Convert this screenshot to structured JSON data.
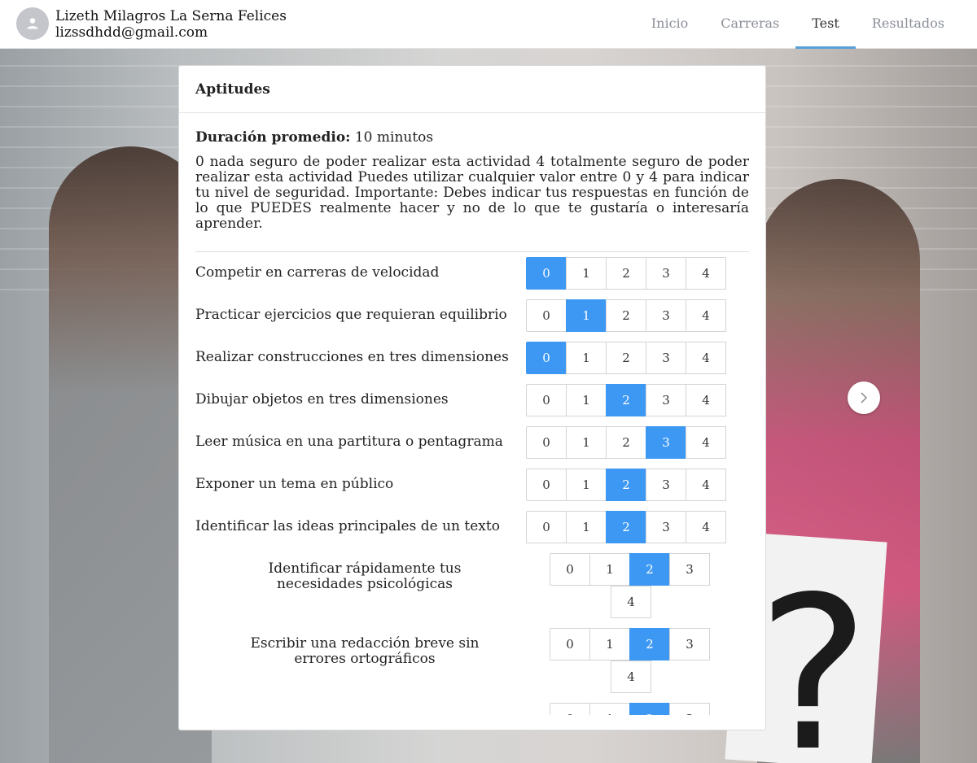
{
  "user": {
    "name": "Lizeth Milagros La Serna Felices",
    "email": "lizssdhdd@gmail.com"
  },
  "nav": [
    {
      "label": "Inicio",
      "active": false
    },
    {
      "label": "Carreras",
      "active": false
    },
    {
      "label": "Test",
      "active": true
    },
    {
      "label": "Resultados",
      "active": false
    }
  ],
  "card": {
    "title": "Aptitudes",
    "duration_label": "Duración promedio:",
    "duration_value": "10 minutos",
    "instructions": "0 nada seguro de poder realizar esta actividad 4 totalmente seguro de poder realizar esta actividad Puedes utilizar cualquier valor entre 0 y 4 para indicar tu nivel de seguridad. Importante: Debes indicar tus respuestas en función de lo que PUEDES realmente hacer y no de lo que te gustaría o interesaría aprender."
  },
  "options": [
    "0",
    "1",
    "2",
    "3",
    "4"
  ],
  "questions": [
    {
      "label": "Competir en carreras de velocidad",
      "selected": 0
    },
    {
      "label": "Practicar ejercicios que requieran equilibrio",
      "selected": 1
    },
    {
      "label": "Realizar construcciones en tres dimensiones",
      "selected": 0
    },
    {
      "label": "Dibujar objetos en tres dimensiones",
      "selected": 2
    },
    {
      "label": "Leer música en una partitura o pentagrama",
      "selected": 3
    },
    {
      "label": "Exponer un tema en público",
      "selected": 2
    },
    {
      "label": "Identificar las ideas principales de un texto",
      "selected": 2
    },
    {
      "label": "Identificar rápidamente tus necesidades psicológicas",
      "selected": 2
    },
    {
      "label": "Escribir una redacción breve sin errores ortográficos",
      "selected": 2
    },
    {
      "label": "",
      "selected": 2
    }
  ],
  "colors": {
    "selected": "#3d98f3",
    "nav_active_underline": "#5aa0d8"
  },
  "icons": {
    "avatar": "person-icon",
    "next": "chevron-right-icon"
  }
}
